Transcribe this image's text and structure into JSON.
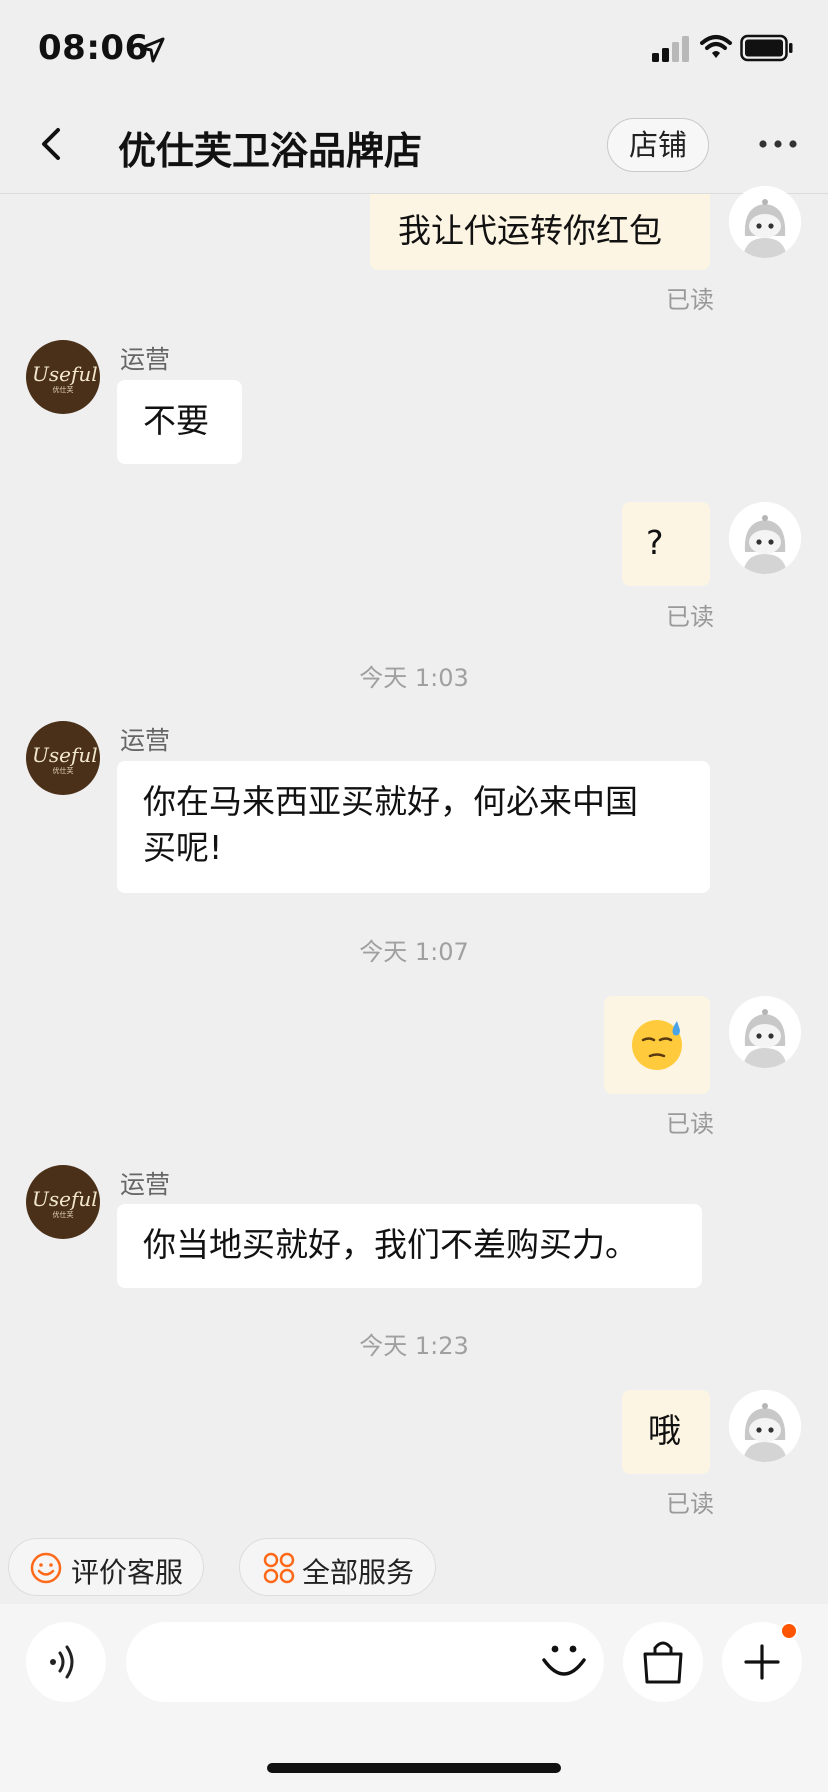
{
  "status_bar": {
    "time": "08:06"
  },
  "header": {
    "title": "优仕芙卫浴品牌店",
    "shop_button": "店铺"
  },
  "shop_logo": {
    "text": "Useful",
    "sub": "优仕芙"
  },
  "messages": [
    {
      "from": "me",
      "text": "我让代运转你红包",
      "status": "已读"
    },
    {
      "from": "shop",
      "sender": "运营",
      "text": "不要"
    },
    {
      "from": "me",
      "text": "?",
      "status": "已读"
    },
    {
      "type": "time",
      "text": "今天 1:03"
    },
    {
      "from": "shop",
      "sender": "运营",
      "lines": [
        "你在马来西亚买就好，何必来中国",
        "买呢!"
      ]
    },
    {
      "type": "time",
      "text": "今天 1:07"
    },
    {
      "from": "me",
      "text": "😓",
      "status": "已读"
    },
    {
      "from": "shop",
      "sender": "运营",
      "text": "你当地买就好，我们不差购买力。"
    },
    {
      "type": "time",
      "text": "今天 1:23"
    },
    {
      "from": "me",
      "text": "哦",
      "status": "已读"
    }
  ],
  "quick_actions": {
    "rate": "评价客服",
    "all_services": "全部服务"
  },
  "input": {
    "placeholder": ""
  },
  "colors": {
    "accent": "#ff5500",
    "my_bubble": "#fdf5e3",
    "shop_avatar": "#4a3018"
  }
}
